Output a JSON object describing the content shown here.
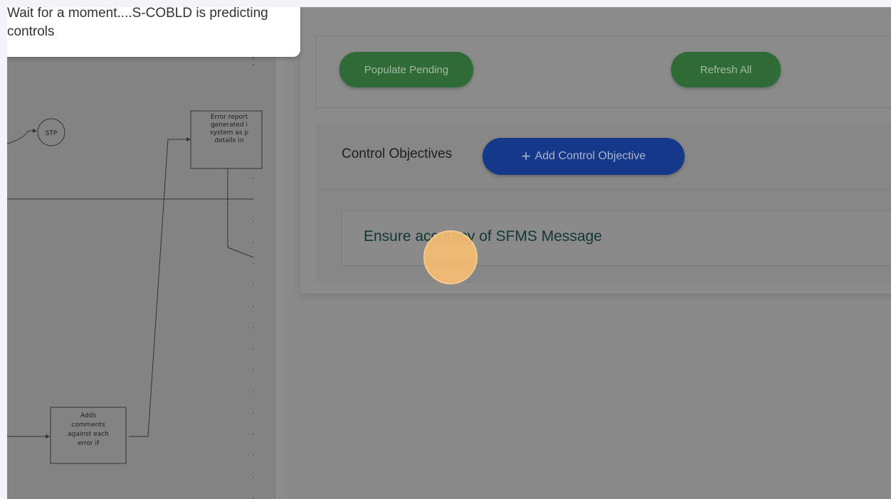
{
  "toast": {
    "message": "Wait for a moment....S-COBLD is predicting controls"
  },
  "diagram": {
    "stp_label": "STP",
    "error_box_lines": [
      "Error report",
      "generated i",
      "system as p",
      "details in"
    ],
    "comments_box_lines": [
      "Adds",
      "comments",
      "against each",
      "error if"
    ]
  },
  "actions": {
    "populate_label": "Populate Pending",
    "refresh_label": "Refresh All"
  },
  "objectives": {
    "title": "Control Objectives",
    "add_label": "Add Control Objective",
    "add_icon": "plus-icon",
    "items": [
      {
        "label": "Ensure accuracy of SFMS Message"
      }
    ]
  },
  "colors": {
    "primary_green": "#2e7d32",
    "primary_blue": "#1e4fbf",
    "click_marker": "#f7b55c"
  }
}
